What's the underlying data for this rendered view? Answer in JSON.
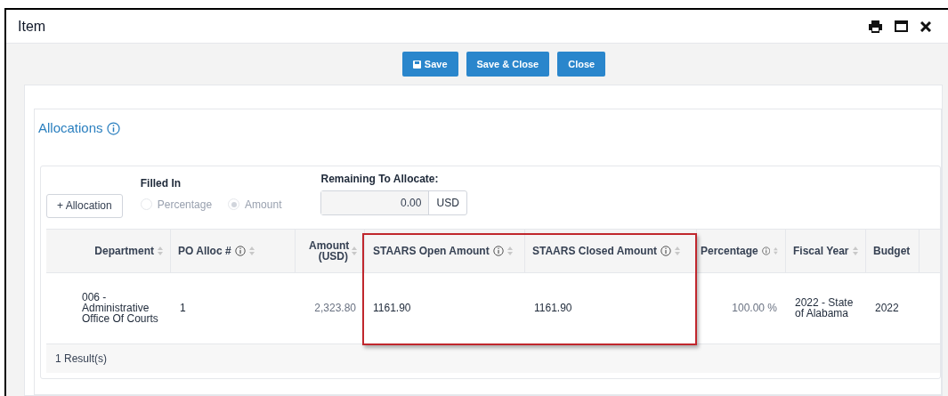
{
  "window": {
    "title": "Item"
  },
  "toolbar": {
    "buttons": [
      {
        "label": "Save",
        "kind": "save"
      },
      {
        "label": "Save & Close",
        "kind": "plain"
      },
      {
        "label": "Close",
        "kind": "plain"
      }
    ]
  },
  "section": {
    "title": "Allocations"
  },
  "add_button": "+ Allocation",
  "filled_in": {
    "label": "Filled In",
    "options": [
      {
        "label": "Percentage",
        "selected": false
      },
      {
        "label": "Amount",
        "selected": true
      }
    ]
  },
  "remaining": {
    "label": "Remaining To Allocate:",
    "value": "0.00",
    "currency": "USD"
  },
  "table": {
    "columns": [
      {
        "label": "Department",
        "info": false,
        "sortable": true
      },
      {
        "label": "PO Alloc #",
        "info": true,
        "sortable": true
      },
      {
        "label": "Amount (USD)",
        "info": false,
        "sortable": true
      },
      {
        "label": "STAARS Open Amount",
        "info": true,
        "sortable": true
      },
      {
        "label": "STAARS Closed Amount",
        "info": true,
        "sortable": true
      },
      {
        "label": "Percentage",
        "info": true,
        "sortable": true
      },
      {
        "label": "Fiscal Year",
        "info": false,
        "sortable": true
      },
      {
        "label": "Budget"
      }
    ],
    "rows": [
      [
        "006 - Administrative Office Of Courts",
        "1",
        "2,323.80",
        "1161.90",
        "1161.90",
        "100.00 %",
        "2022 - State of Alabama",
        "2022"
      ]
    ],
    "footer": "1 Result(s)"
  }
}
